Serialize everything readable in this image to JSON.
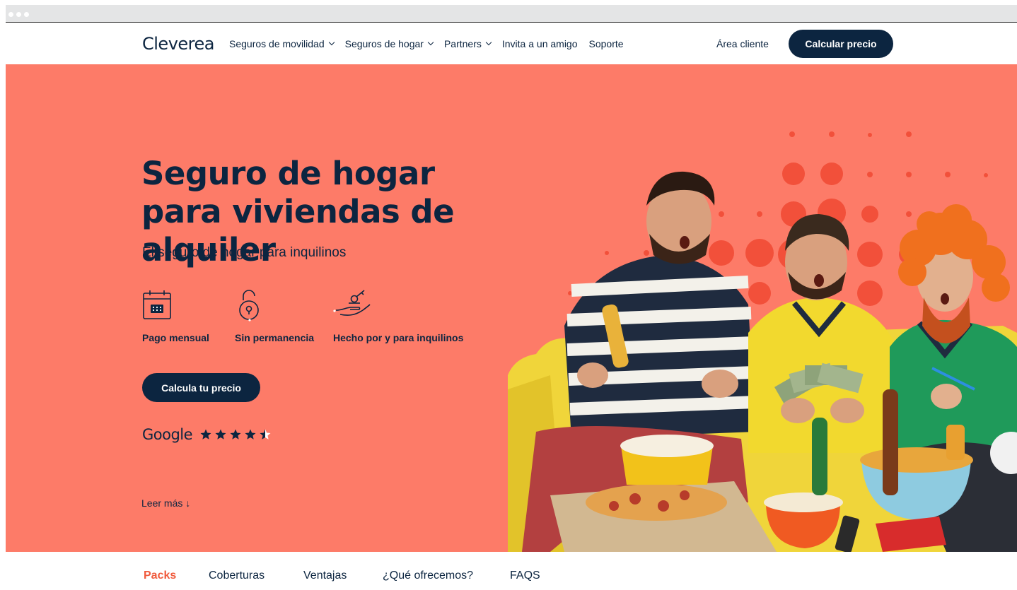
{
  "brand": {
    "logo_text": "Cleverea",
    "hero_bg": "#fd7b68",
    "navy": "#0c2540",
    "active_tab_color": "#f05a3c"
  },
  "nav": {
    "items": [
      {
        "label": "Seguros de movilidad",
        "has_dropdown": true
      },
      {
        "label": "Seguros de hogar",
        "has_dropdown": true
      },
      {
        "label": "Partners",
        "has_dropdown": true
      },
      {
        "label": "Invita a un amigo",
        "has_dropdown": false
      },
      {
        "label": "Soporte",
        "has_dropdown": false
      }
    ],
    "client_area": "Área cliente",
    "cta": "Calcular precio"
  },
  "hero": {
    "title": "Seguro de hogar para viviendas de alquiler",
    "subtitle": "El seguro de hogar para inquilinos",
    "features": [
      {
        "icon": "calendar-icon",
        "label": "Pago mensual"
      },
      {
        "icon": "open-padlock-icon",
        "label": "Sin permanencia"
      },
      {
        "icon": "hand-key-icon",
        "label": "Hecho por y para inquilinos"
      }
    ],
    "cta": "Calcula tu precio",
    "rating_source": "Google",
    "rating_stars": 4.5,
    "read_more": "Leer más ↓"
  },
  "tabs": [
    {
      "label": "Packs",
      "active": true
    },
    {
      "label": "Coberturas",
      "active": false
    },
    {
      "label": "Ventajas",
      "active": false
    },
    {
      "label": "¿Qué ofrecemos?",
      "active": false
    },
    {
      "label": "FAQS",
      "active": false
    }
  ]
}
